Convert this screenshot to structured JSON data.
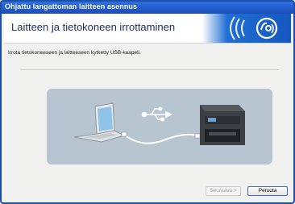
{
  "window": {
    "title": "Ohjattu langattoman laitteen asennus"
  },
  "header": {
    "title": "Laitteen ja tietokoneen irrottaminen"
  },
  "main": {
    "instruction": "Irrota tietokoneeseen ja laitteeseen kytketty USB-kaapeli."
  },
  "buttons": {
    "next_label": "Seuraava >",
    "cancel_label": "Peruuta"
  },
  "colors": {
    "titlebar": "#1a4db8",
    "banner": "#1f6ed3",
    "illustration_bg": "#b7c5d1"
  },
  "icons": {
    "banner_logo": "wireless-logo-icon",
    "usb": "usb-icon"
  }
}
